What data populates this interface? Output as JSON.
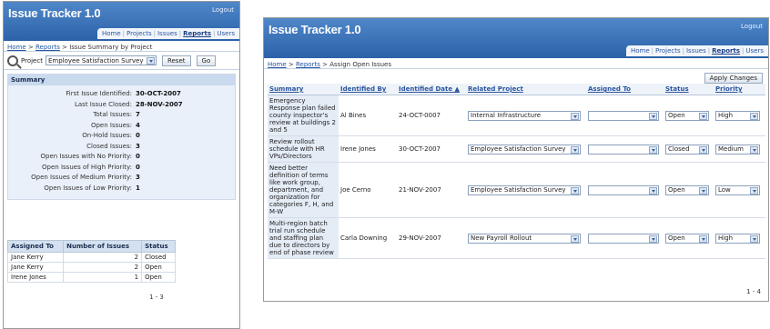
{
  "left": {
    "app_title": "Issue Tracker 1.0",
    "logout": "Logout",
    "nav": [
      "Home",
      "Projects",
      "Issues",
      "Reports",
      "Users"
    ],
    "active_nav": "Reports",
    "breadcrumb": {
      "home": "Home",
      "reports": "Reports",
      "current": "Issue Summary by Project"
    },
    "filter": {
      "label": "Project",
      "project": "Employee Satisfaction Survey",
      "reset": "Reset",
      "go": "Go"
    },
    "summary": {
      "title": "Summary",
      "rows": [
        {
          "label": "First Issue Identified:",
          "value": "30-OCT-2007"
        },
        {
          "label": "Last Issue Closed:",
          "value": "28-NOV-2007"
        },
        {
          "label": "Total Issues:",
          "value": "7"
        },
        {
          "label": "Open Issues:",
          "value": "4"
        },
        {
          "label": "On-Hold Issues:",
          "value": "0"
        },
        {
          "label": "Closed Issues:",
          "value": "3"
        },
        {
          "label": "Open Issues with No Priority:",
          "value": "0"
        },
        {
          "label": "Open Issues of High Priority:",
          "value": "0"
        },
        {
          "label": "Open Issues of Medium Priority:",
          "value": "3"
        },
        {
          "label": "Open Issues of Low Priority:",
          "value": "1"
        }
      ]
    },
    "assigned_table": {
      "headers": [
        "Assigned To",
        "Number of Issues",
        "Status"
      ],
      "rows": [
        [
          "Jane Kerry",
          "2",
          "Closed"
        ],
        [
          "Jane Kerry",
          "2",
          "Open"
        ],
        [
          "Irene Jones",
          "1",
          "Open"
        ]
      ],
      "pager": "1 - 3"
    }
  },
  "right": {
    "app_title": "Issue Tracker 1.0",
    "logout": "Logout",
    "nav": [
      "Home",
      "Projects",
      "Issues",
      "Reports",
      "Users"
    ],
    "active_nav": "Reports",
    "breadcrumb": {
      "home": "Home",
      "reports": "Reports",
      "current": "Assign Open Issues"
    },
    "apply_changes": "Apply Changes",
    "table": {
      "headers": [
        "Summary",
        "Identified By",
        "Identified Date ▲",
        "Related Project",
        "Assigned To",
        "Status",
        "Priority"
      ],
      "rows": [
        {
          "summary": "Emergency Response plan failed county inspector's review at buildings 2 and 5",
          "identified_by": "Al Bines",
          "date": "24-OCT-0007",
          "project": "Internal Infrastructure",
          "assigned": "",
          "status": "Open",
          "priority": "High"
        },
        {
          "summary": "Review rollout schedule with HR VPs/Directors",
          "identified_by": "Irene Jones",
          "date": "30-OCT-2007",
          "project": "Employee Satisfaction Survey",
          "assigned": "",
          "status": "Closed",
          "priority": "Medium"
        },
        {
          "summary": "Need better definition of terms like work group, department, and organization for categories F, H, and M-W",
          "identified_by": "Joe Cerno",
          "date": "21-NOV-2007",
          "project": "Employee Satisfaction Survey",
          "assigned": "",
          "status": "Open",
          "priority": "Low"
        },
        {
          "summary": "Multi-region batch trial run schedule and staffing plan due to directors by end of phase review",
          "identified_by": "Carla Downing",
          "date": "29-NOV-2007",
          "project": "New Payroll Rollout",
          "assigned": "",
          "status": "Open",
          "priority": "High"
        }
      ],
      "pager": "1 - 4"
    }
  }
}
